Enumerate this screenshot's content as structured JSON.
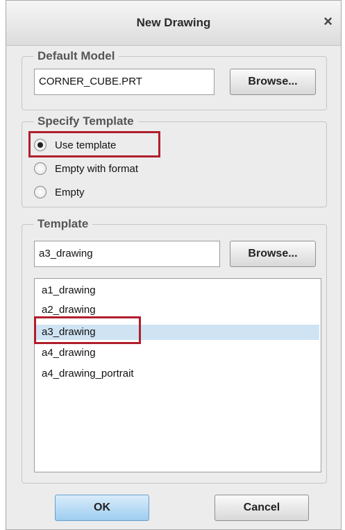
{
  "dialog": {
    "title": "New Drawing",
    "close_glyph": "×",
    "close_icon": "close-icon"
  },
  "default_model": {
    "legend": "Default Model",
    "value": "CORNER_CUBE.PRT",
    "browse_label": "Browse..."
  },
  "specify_template": {
    "legend": "Specify Template",
    "options": [
      {
        "label": "Use template",
        "selected": true
      },
      {
        "label": "Empty with format",
        "selected": false
      },
      {
        "label": "Empty",
        "selected": false
      }
    ]
  },
  "template": {
    "legend": "Template",
    "value": "a3_drawing",
    "browse_label": "Browse...",
    "list": [
      {
        "label": "a1_drawing",
        "selected": false
      },
      {
        "label": "a2_drawing",
        "selected": false
      },
      {
        "label": "a3_drawing",
        "selected": true
      },
      {
        "label": "a4_drawing",
        "selected": false
      },
      {
        "label": "a4_drawing_portrait",
        "selected": false
      }
    ]
  },
  "footer": {
    "ok_label": "OK",
    "cancel_label": "Cancel"
  },
  "colors": {
    "highlight": "#b01e2c",
    "selection": "#cfe3f3",
    "ok_button": "#9ecdf0"
  }
}
